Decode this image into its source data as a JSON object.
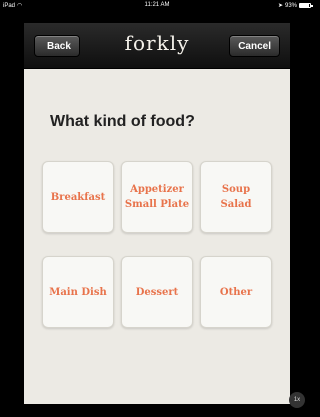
{
  "status_bar": {
    "carrier": "iPad",
    "time": "11:21 AM",
    "battery": "93%"
  },
  "nav": {
    "back_label": "Back",
    "title": "forkly",
    "cancel_label": "Cancel"
  },
  "question": "What kind of food?",
  "tiles": [
    {
      "line1": "Breakfast",
      "line2": ""
    },
    {
      "line1": "Appetizer",
      "line2": "Small Plate"
    },
    {
      "line1": "Soup",
      "line2": "Salad"
    },
    {
      "line1": "Main Dish",
      "line2": ""
    },
    {
      "line1": "Dessert",
      "line2": ""
    },
    {
      "line1": "Other",
      "line2": ""
    }
  ],
  "corner_button": "1x",
  "colors": {
    "accent": "#e8734b",
    "nav_bg": "#1a1a1a",
    "content_bg": "#eceae4"
  }
}
